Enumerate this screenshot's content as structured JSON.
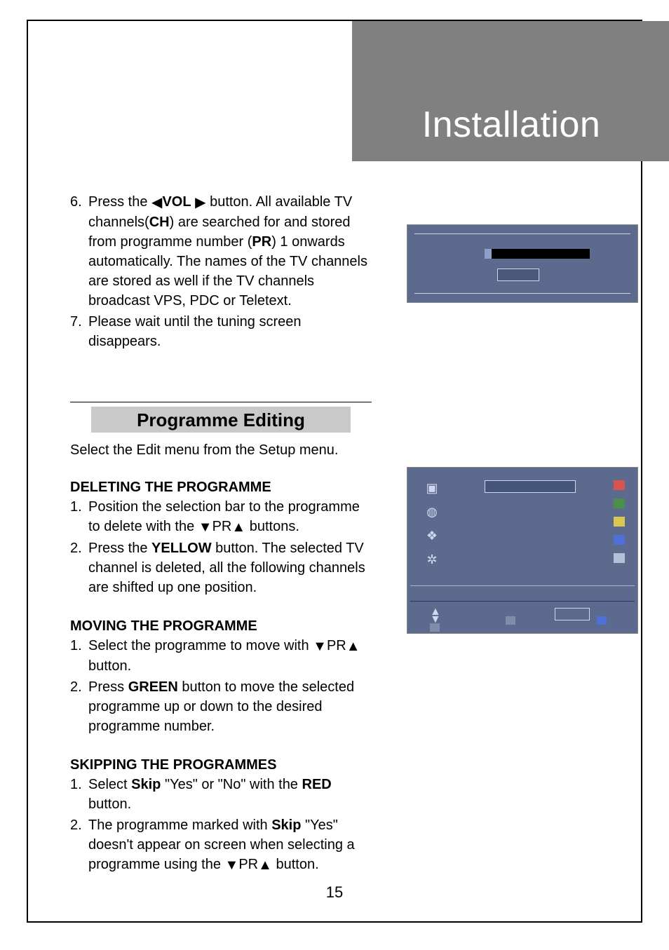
{
  "header": {
    "title": "Installation"
  },
  "page_number": "15",
  "step6": {
    "num": "6.",
    "pre": "Press the  ",
    "vol": "VOL",
    "mid1": " button. All available TV channels(",
    "ch": "CH",
    "mid2": ") are searched for and stored from programme number (",
    "pr": "PR",
    "mid3": ") 1 onwards automatically. The names of the TV channels are stored as well if the TV channels broadcast VPS, PDC or Teletext."
  },
  "step7": {
    "num": "7.",
    "text": "Please wait until the tuning screen disappears."
  },
  "section": {
    "heading": "Programme Editing",
    "intro_pre": "Select the ",
    "intro_edit": "Edit",
    "intro_mid": " menu from the ",
    "intro_setup": "Setup",
    "intro_post": " menu."
  },
  "deleting": {
    "head": "DELETING THE PROGRAMME",
    "s1": {
      "num": "1.",
      "pre": "Position the selection bar to the programme to delete with the ",
      "pr": "PR",
      "post": " buttons."
    },
    "s2": {
      "num": "2.",
      "pre": "Press the ",
      "yellow": "YELLOW",
      "post": " button. The selected TV channel is deleted, all the following channels are shifted up one position."
    }
  },
  "moving": {
    "head": "MOVING THE PROGRAMME",
    "s1": {
      "num": "1.",
      "pre": "Select the programme to move with ",
      "pr": "PR",
      "post": " button."
    },
    "s2": {
      "num": "2.",
      "pre": "Press ",
      "green": "GREEN",
      "post": " button to move the selected programme up or down to the desired programme number."
    }
  },
  "skipping": {
    "head": "SKIPPING THE PROGRAMMES",
    "s1": {
      "num": "1.",
      "pre": "Select ",
      "skip": "Skip",
      "mid": " \"Yes\" or \"No\" with the ",
      "red": "RED",
      "post": " button."
    },
    "s2": {
      "num": "2.",
      "pre": "The programme marked with ",
      "skip": "Skip",
      "mid": " \"Yes\" doesn't appear on screen when selecting a programme using the ",
      "pr": "PR",
      "post": " button."
    }
  }
}
